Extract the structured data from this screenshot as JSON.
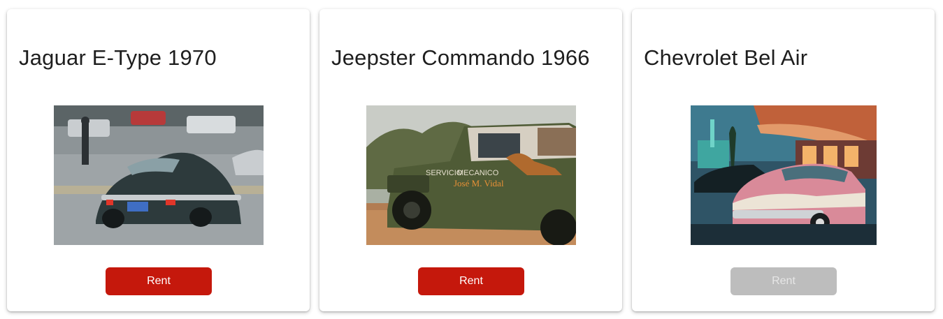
{
  "cars": [
    {
      "title": "Jaguar E-Type 1970",
      "image": "jaguar-e-type-photo",
      "button_label": "Rent",
      "available": true
    },
    {
      "title": "Jeepster Commando 1966",
      "image": "jeepster-commando-photo",
      "button_label": "Rent",
      "available": true
    },
    {
      "title": "Chevrolet Bel Air",
      "image": "chevrolet-bel-air-photo",
      "button_label": "Rent",
      "available": false
    }
  ],
  "colors": {
    "rent_button": "#c5180c",
    "rent_button_disabled": "#bdbdbd",
    "title_text": "#1e1e1e",
    "card_background": "#ffffff"
  }
}
